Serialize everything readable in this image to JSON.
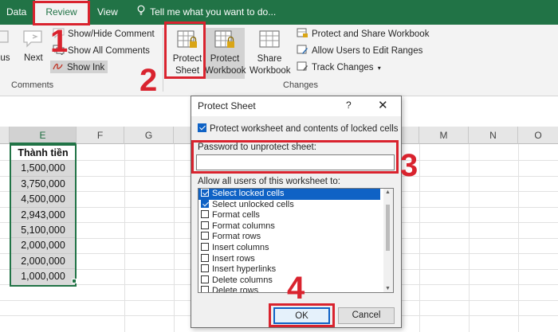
{
  "ribbon": {
    "tabs": {
      "data": "Data",
      "review": "Review",
      "view": "View"
    },
    "tell_me": "Tell me what you want to do...",
    "comments_group": {
      "label": "Comments",
      "previous": "ous",
      "next": "Next",
      "show_hide": "Show/Hide Comment",
      "show_all": "Show All Comments",
      "show_ink": "Show Ink"
    },
    "changes_group": {
      "label": "Changes",
      "protect_sheet": [
        "Protect",
        "Sheet"
      ],
      "protect_workbook": [
        "Protect",
        "Workbook"
      ],
      "share_workbook": [
        "Share",
        "Workbook"
      ],
      "protect_and_share": "Protect and Share Workbook",
      "allow_users": "Allow Users to Edit Ranges",
      "track_changes": "Track Changes"
    }
  },
  "sheet": {
    "columns": [
      "E",
      "F",
      "G",
      "M",
      "N",
      "O"
    ],
    "header_cell": "Thành tiền",
    "values": [
      "1,500,000",
      "3,750,000",
      "4,500,000",
      "2,943,000",
      "5,100,000",
      "2,000,000",
      "2,000,000",
      "1,000,000"
    ]
  },
  "dialog": {
    "title": "Protect Sheet",
    "help": "?",
    "close": "✕",
    "protect_checkbox": "Protect worksheet and contents of locked cells",
    "password_label": "Password to unprotect sheet:",
    "password_value": "",
    "allow_label": "Allow all users of this worksheet to:",
    "options": [
      {
        "label": "Select locked cells",
        "checked": true
      },
      {
        "label": "Select unlocked cells",
        "checked": true
      },
      {
        "label": "Format cells",
        "checked": false
      },
      {
        "label": "Format columns",
        "checked": false
      },
      {
        "label": "Format rows",
        "checked": false
      },
      {
        "label": "Insert columns",
        "checked": false
      },
      {
        "label": "Insert rows",
        "checked": false
      },
      {
        "label": "Insert hyperlinks",
        "checked": false
      },
      {
        "label": "Delete columns",
        "checked": false
      },
      {
        "label": "Delete rows",
        "checked": false
      }
    ],
    "ok": "OK",
    "cancel": "Cancel"
  },
  "annotations": {
    "step1": "1",
    "step2": "2",
    "step3": "3",
    "step4": "4"
  },
  "colors": {
    "excel_green": "#217346",
    "highlight_red": "#d9232e",
    "selection_blue": "#0f62c5"
  }
}
